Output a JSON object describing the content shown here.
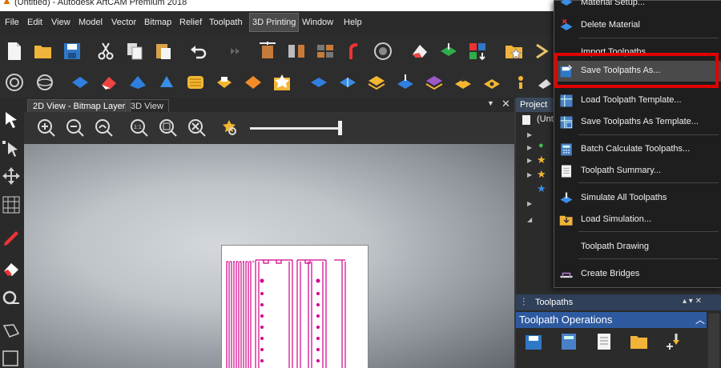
{
  "window": {
    "title": "(Untitled) - Autodesk ArtCAM Premium 2018"
  },
  "menu": [
    "File",
    "Edit",
    "View",
    "Model",
    "Vector",
    "Bitmap",
    "Relief",
    "Toolpath",
    "3D Printing",
    "Window",
    "Help"
  ],
  "menu_active": "3D Printing",
  "view_tabs": [
    "2D View - Bitmap Layer",
    "3D View"
  ],
  "project_panel": {
    "title": "Project",
    "root_label": "(Unti"
  },
  "toolpaths_panel": {
    "title": "Toolpaths",
    "operations_label": "Toolpath Operations"
  },
  "dropdown": {
    "items": [
      {
        "label": "Material Setup...",
        "icon": "material-setup-icon"
      },
      {
        "label": "Delete Material",
        "icon": "delete-material-icon"
      },
      {
        "label": "Import Toolpaths...",
        "icon": "import-toolpaths-icon"
      },
      {
        "label": "Save Toolpaths As...",
        "icon": "save-toolpaths-icon"
      },
      {
        "label": "Load Toolpath Template...",
        "icon": "load-template-icon"
      },
      {
        "label": "Save Toolpaths As Template...",
        "icon": "save-template-icon"
      },
      {
        "label": "Batch Calculate Toolpaths...",
        "icon": "batch-calculate-icon"
      },
      {
        "label": "Toolpath Summary...",
        "icon": "toolpath-summary-icon"
      },
      {
        "label": "Simulate All Toolpaths",
        "icon": "simulate-icon"
      },
      {
        "label": "Load Simulation...",
        "icon": "load-simulation-icon"
      },
      {
        "label": "Toolpath Drawing",
        "icon": ""
      },
      {
        "label": "Create Bridges",
        "icon": "create-bridges-icon"
      }
    ],
    "highlighted": "Save Toolpaths As..."
  },
  "colors": {
    "accent": "#2e5aa0",
    "highlight_box": "#e00000",
    "toolpath": "#d0008a"
  }
}
